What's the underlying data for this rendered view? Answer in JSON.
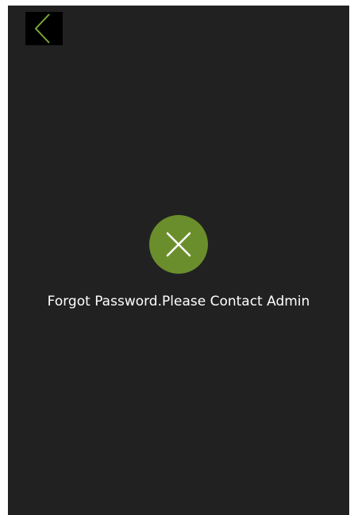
{
  "header": {
    "back_icon": "chevron-left-icon"
  },
  "status": {
    "icon": "close-icon",
    "message": "Forgot Password.Please Contact Admin"
  },
  "colors": {
    "background": "#212121",
    "back_button_bg": "#000000",
    "accent": "#6b8e2c",
    "chevron": "#7aa936",
    "text": "#ffffff"
  }
}
